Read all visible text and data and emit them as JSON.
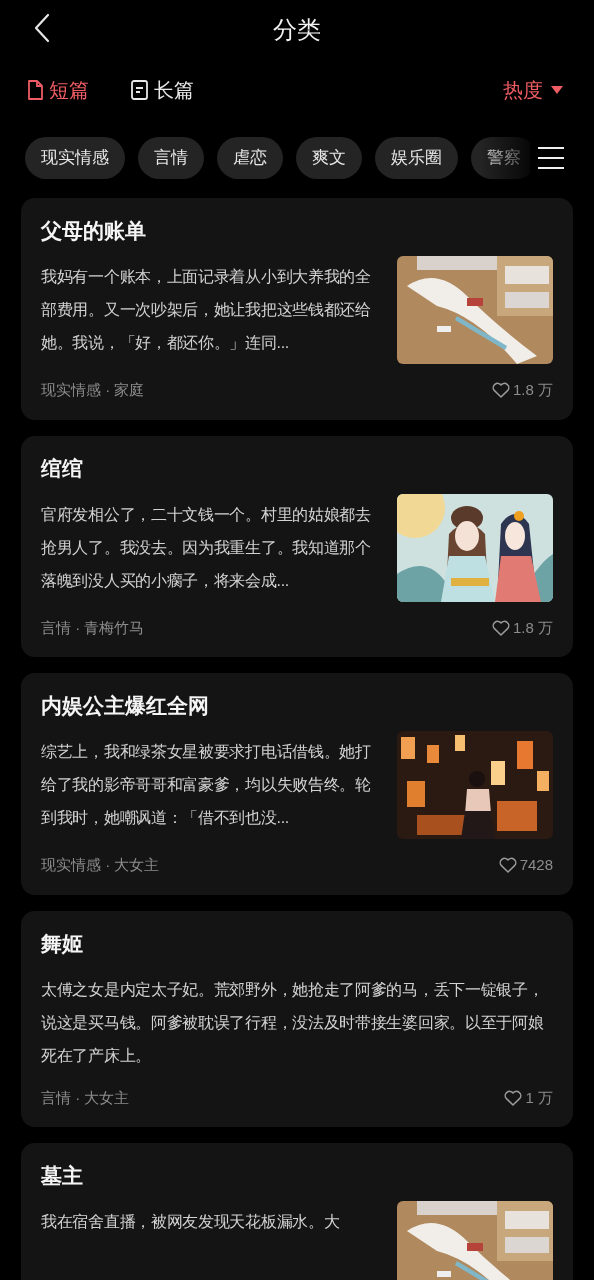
{
  "header": {
    "title": "分类"
  },
  "tabs": [
    {
      "label": "短篇",
      "selected": true,
      "kind": "file"
    },
    {
      "label": "长篇",
      "selected": false,
      "kind": "doc"
    }
  ],
  "sort": {
    "label": "热度"
  },
  "chips": [
    {
      "label": "现实情感"
    },
    {
      "label": "言情"
    },
    {
      "label": "虐恋"
    },
    {
      "label": "爽文"
    },
    {
      "label": "娱乐圈"
    },
    {
      "label": "警察"
    }
  ],
  "stories": [
    {
      "title": "父母的账单",
      "excerpt": "我妈有一个账本，上面记录着从小到大养我的全部费用。又一次吵架后，她让我把这些钱都还给她。我说，「好，都还你。」连同...",
      "tags": "现实情感 · 家庭",
      "likes": "1.8 万"
    },
    {
      "title": "绾绾",
      "excerpt": "官府发相公了，二十文钱一个。村里的姑娘都去抢男人了。我没去。因为我重生了。我知道那个落魄到没人买的小瘸子，将来会成...",
      "tags": "言情 · 青梅竹马",
      "likes": "1.8 万"
    },
    {
      "title": "内娱公主爆红全网",
      "excerpt": "综艺上，我和绿茶女星被要求打电话借钱。她打给了我的影帝哥哥和富豪爹，均以失败告终。轮到我时，她嘲讽道：「借不到也没...",
      "tags": "现实情感 · 大女主",
      "likes": "7428"
    },
    {
      "title": "舞姬",
      "excerpt": "太傅之女是内定太子妃。荒郊野外，她抢走了阿爹的马，丢下一锭银子，说这是买马钱。阿爹被耽误了行程，没法及时带接生婆回家。以至于阿娘死在了产床上。",
      "tags": "言情 · 大女主",
      "likes": "1 万"
    },
    {
      "title": "墓主",
      "excerpt": "我在宿舍直播，被网友发现天花板漏水。大"
    }
  ]
}
